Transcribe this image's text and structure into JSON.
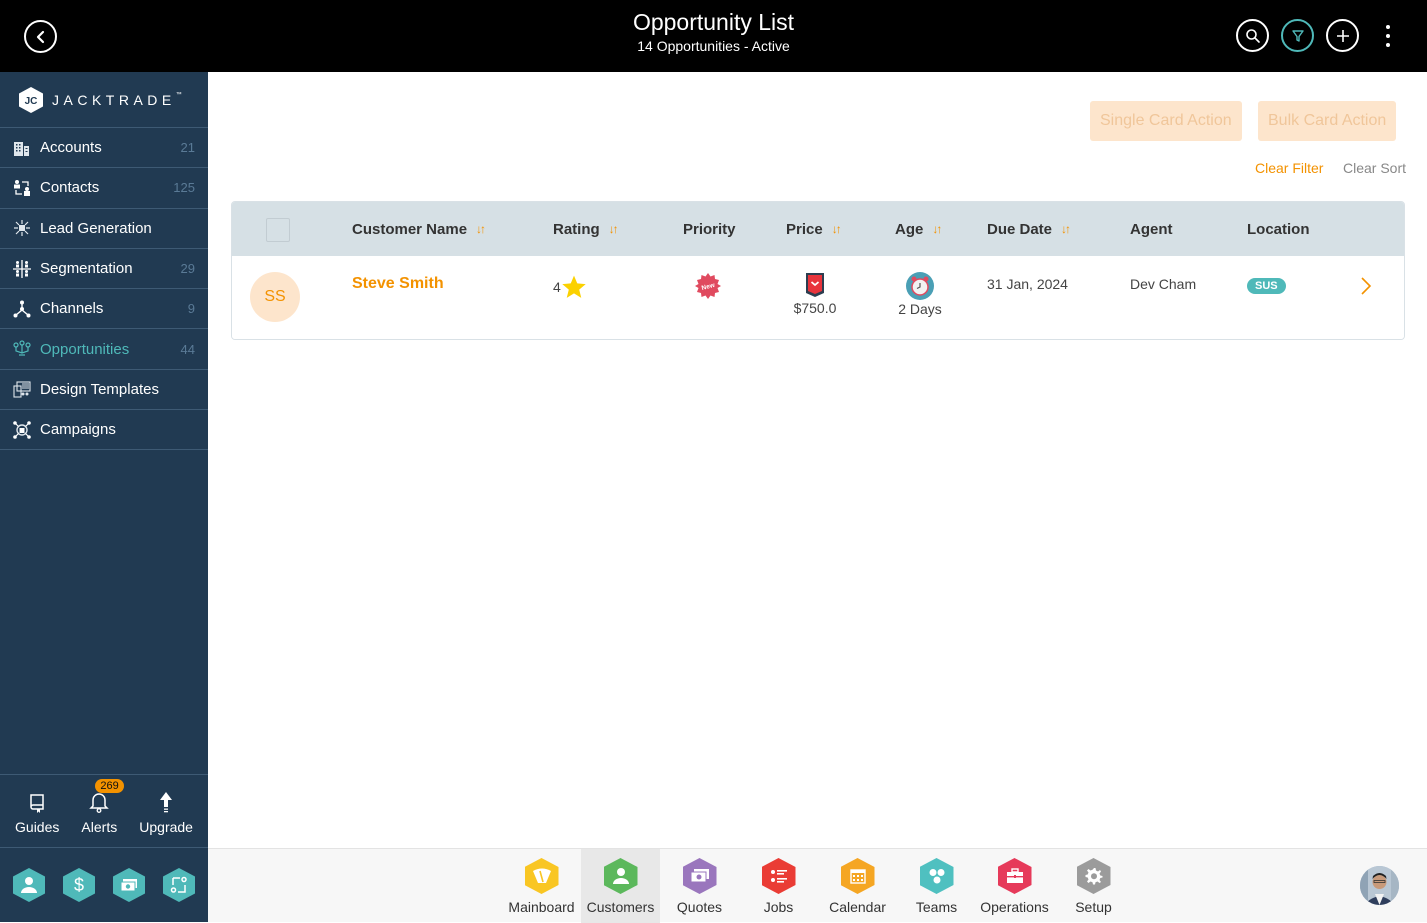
{
  "header": {
    "title": "Opportunity List",
    "subtitle": "14 Opportunities - Active",
    "icons": [
      "back-icon",
      "search-icon",
      "filter-icon",
      "add-icon",
      "more-vertical-icon"
    ]
  },
  "sidebar": {
    "brand": "JACKTRADE",
    "brand_tm": "™",
    "items": [
      {
        "label": "Accounts",
        "count": "21",
        "icon": "building-icon"
      },
      {
        "label": "Contacts",
        "count": "125",
        "icon": "contacts-icon"
      },
      {
        "label": "Lead Generation",
        "count": "",
        "icon": "lead-generation-icon"
      },
      {
        "label": "Segmentation",
        "count": "29",
        "icon": "segmentation-icon"
      },
      {
        "label": "Channels",
        "count": "9",
        "icon": "channels-icon"
      },
      {
        "label": "Opportunities",
        "count": "44",
        "icon": "opportunities-icon",
        "active": true
      },
      {
        "label": "Design Templates",
        "count": "",
        "icon": "design-templates-icon"
      },
      {
        "label": "Campaigns",
        "count": "",
        "icon": "campaigns-icon"
      }
    ],
    "tools": [
      {
        "label": "Guides",
        "icon": "book-icon"
      },
      {
        "label": "Alerts",
        "icon": "bell-icon",
        "badge": "269"
      },
      {
        "label": "Upgrade",
        "icon": "arrow-up-icon"
      }
    ],
    "quick_apps": [
      "person-icon",
      "dollar-icon",
      "quote-icon",
      "workflow-icon"
    ],
    "accent_color": "#4fb9b9"
  },
  "toolbar": {
    "single_card_action": "Single Card Action",
    "bulk_card_action": "Bulk Card Action",
    "clear_filter": "Clear Filter",
    "clear_sort": "Clear Sort"
  },
  "table": {
    "columns": [
      {
        "label": "Customer Name",
        "sortable": true
      },
      {
        "label": "Rating",
        "sortable": true
      },
      {
        "label": "Priority",
        "sortable": false
      },
      {
        "label": "Price",
        "sortable": true
      },
      {
        "label": "Age",
        "sortable": true
      },
      {
        "label": "Due Date",
        "sortable": true
      },
      {
        "label": "Agent",
        "sortable": false
      },
      {
        "label": "Location",
        "sortable": false
      }
    ],
    "sort_glyph": "↓↑",
    "rows": [
      {
        "initials": "SS",
        "customer_name": "Steve Smith",
        "rating": "4",
        "priority": "New",
        "price": "$750.0",
        "age": "2 Days",
        "due_date": "31 Jan, 2024",
        "agent": "Dev Cham",
        "location": "SUS"
      }
    ]
  },
  "bottom_nav": {
    "items": [
      {
        "label": "Mainboard",
        "color": "#f9c623",
        "icon": "mainboard-icon"
      },
      {
        "label": "Customers",
        "color": "#5cb85c",
        "icon": "customer-icon",
        "active": true
      },
      {
        "label": "Quotes",
        "color": "#9a76bd",
        "icon": "quotes-icon"
      },
      {
        "label": "Jobs",
        "color": "#ea3c35",
        "icon": "jobs-icon"
      },
      {
        "label": "Calendar",
        "color": "#f5a623",
        "icon": "calendar-icon"
      },
      {
        "label": "Teams",
        "color": "#4fc0c0",
        "icon": "teams-icon"
      },
      {
        "label": "Operations",
        "color": "#e63a5a",
        "icon": "operations-icon"
      },
      {
        "label": "Setup",
        "color": "#9b9b9b",
        "icon": "gear-icon"
      }
    ]
  }
}
